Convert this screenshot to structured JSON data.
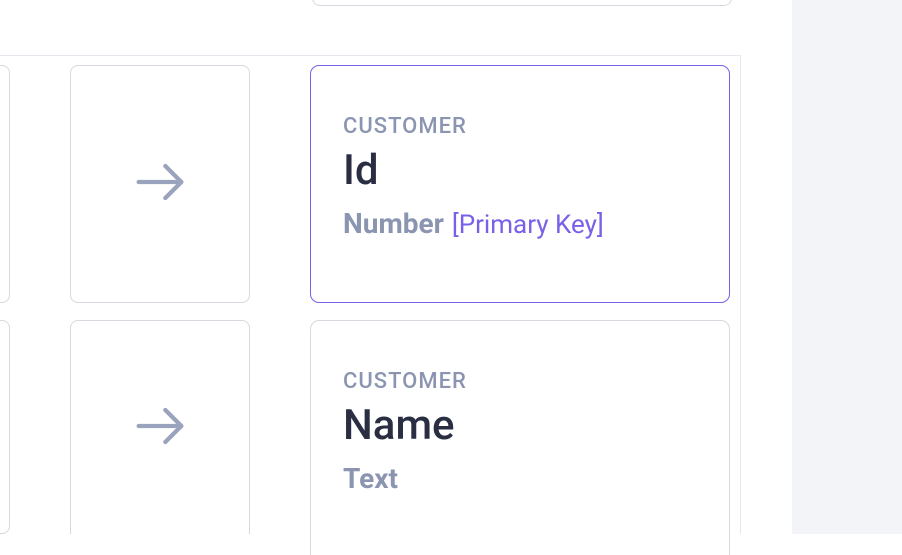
{
  "fields": [
    {
      "entity": "CUSTOMER",
      "name": "Id",
      "type": "Number",
      "badge": "[Primary Key]",
      "selected": true
    },
    {
      "entity": "CUSTOMER",
      "name": "Name",
      "type": "Text",
      "badge": "",
      "selected": false
    }
  ],
  "colors": {
    "accent": "#7a60e8",
    "muted": "#8b95b1",
    "text": "#2a2e43",
    "border": "#d7d9e0"
  }
}
